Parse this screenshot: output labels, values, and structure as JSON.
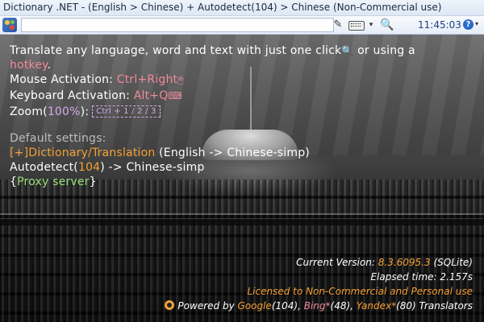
{
  "window": {
    "title": "Dictionary .NET - (English > Chinese) + Autodetect(104) > Chinese (Non-Commercial use)"
  },
  "toolbar": {
    "search_value": "",
    "pen_icon": "pen-icon",
    "keyboard_icon": "keyboard-icon",
    "dropdown_arrow": "▾",
    "search_icon": "🔍",
    "time": "11:45:03",
    "help_icon": "?",
    "help_dropdown": "▾"
  },
  "intro": {
    "line1_part1": "Translate any language, word and text with just one click",
    "line1_click_icon": "🔍",
    "line1_part2": " or using a",
    "line2_hotkey": "hotkey",
    "line2_dot": ".",
    "mouse_label": "Mouse Activation: ",
    "mouse_value": "Ctrl+Right",
    "mouse_icon": "🖱",
    "keyboard_label": "Keyboard Activation: ",
    "keyboard_value": "Alt+Q",
    "keyboard_icon": "⌨",
    "zoom_label": "Zoom(",
    "zoom_value": "100%",
    "zoom_close": "):",
    "zoom_shortcut": "Ctrl + 1 / 2 / 3"
  },
  "defaults": {
    "heading": "Default settings:",
    "dictionary_link": "[+]Dictionary/Translation",
    "dictionary_pair": " (English -> Chinese-simp)",
    "autodetect_prefix": "Autodetect(",
    "autodetect_count": "104",
    "autodetect_suffix": ") -> Chinese-simp",
    "proxy_open": "{",
    "proxy_link": "Proxy server",
    "proxy_close": "}"
  },
  "info": {
    "version_label": "Current Version: ",
    "version_value": "8.3.6095.3",
    "version_db": " (SQLite)",
    "elapsed": "Elapsed time: 2.157s",
    "license": "Licensed to Non-Commercial and Personal use",
    "powered_prefix": "Powered by ",
    "google": "Google",
    "google_count": "(104), ",
    "bing": "Bing*",
    "bing_count": "(48), ",
    "yandex": "Yandex*",
    "yandex_count": "(80) Translators"
  },
  "colors": {
    "accent_pink": "#f08a9b",
    "accent_orange": "#f5a034",
    "accent_violet": "#d8a8e8",
    "accent_green": "#9be07a"
  }
}
